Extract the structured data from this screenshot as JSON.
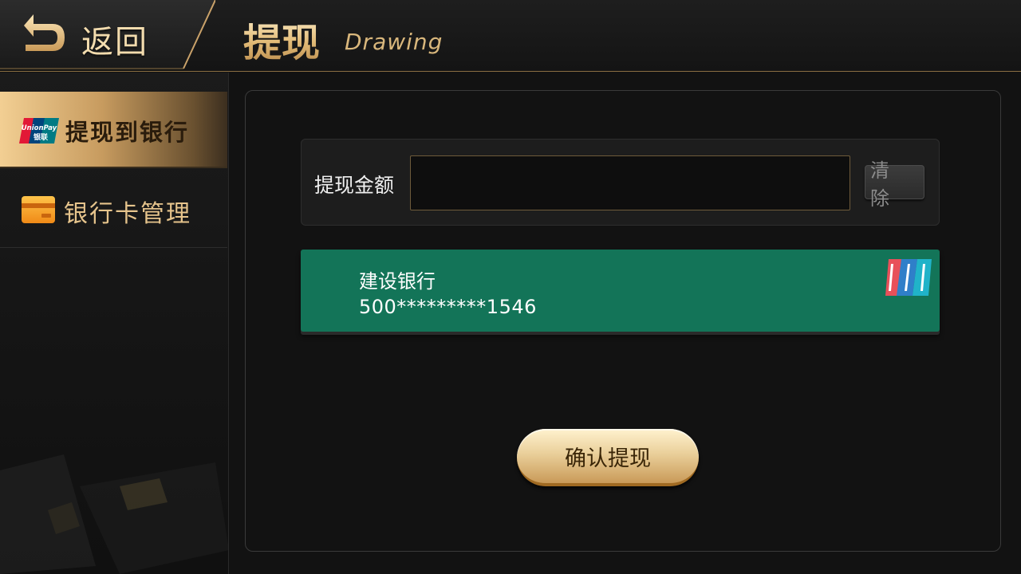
{
  "header": {
    "back_label": "返回",
    "title": "提现",
    "subtitle": "Drawing"
  },
  "sidebar": {
    "items": [
      {
        "label": "提现到银行",
        "icon": "unionpay-icon",
        "active": true
      },
      {
        "label": "银行卡管理",
        "icon": "bank-card-icon",
        "active": false
      }
    ]
  },
  "withdraw": {
    "amount_label": "提现金额",
    "amount_value": "",
    "clear_label": "清 除"
  },
  "bank_card": {
    "bank_name": "建设银行",
    "card_number": "500*********1546",
    "color": "#137458"
  },
  "confirm_label": "确认提现",
  "colors": {
    "accent_gold": "#e2bb77",
    "card_green": "#137458",
    "background": "#121212"
  }
}
